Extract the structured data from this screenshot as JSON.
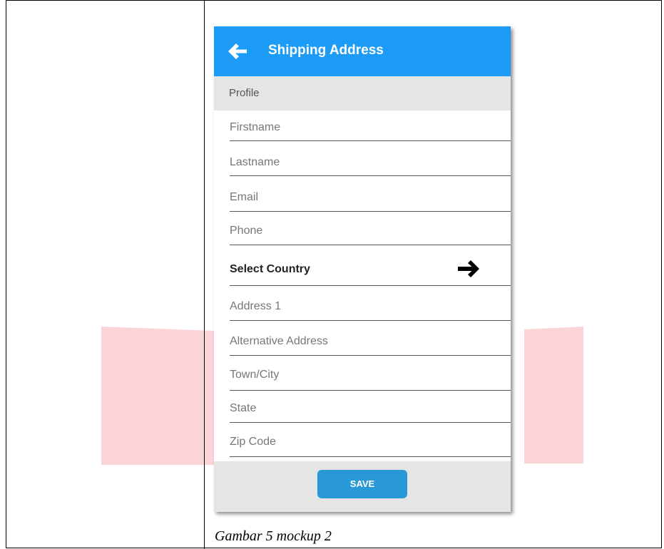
{
  "app": {
    "title": "Shipping Address",
    "back_icon": "arrow-left-icon",
    "colors": {
      "appbar": "#1c9cf6",
      "save_button": "#2899d6",
      "section_background": "#e5e5e5"
    }
  },
  "section": {
    "label": "Profile"
  },
  "fields": [
    {
      "label": "Firstname"
    },
    {
      "label": "Lastname"
    },
    {
      "label": "Email"
    },
    {
      "label": "Phone"
    },
    {
      "label": "Select Country",
      "icon": "arrow-right-icon"
    },
    {
      "label": "Address 1"
    },
    {
      "label": "Alternative Address"
    },
    {
      "label": "Town/City"
    },
    {
      "label": "State"
    },
    {
      "label": "Zip Code"
    }
  ],
  "footer": {
    "save_label": "SAVE"
  },
  "caption": "Gambar 5 mockup 2"
}
